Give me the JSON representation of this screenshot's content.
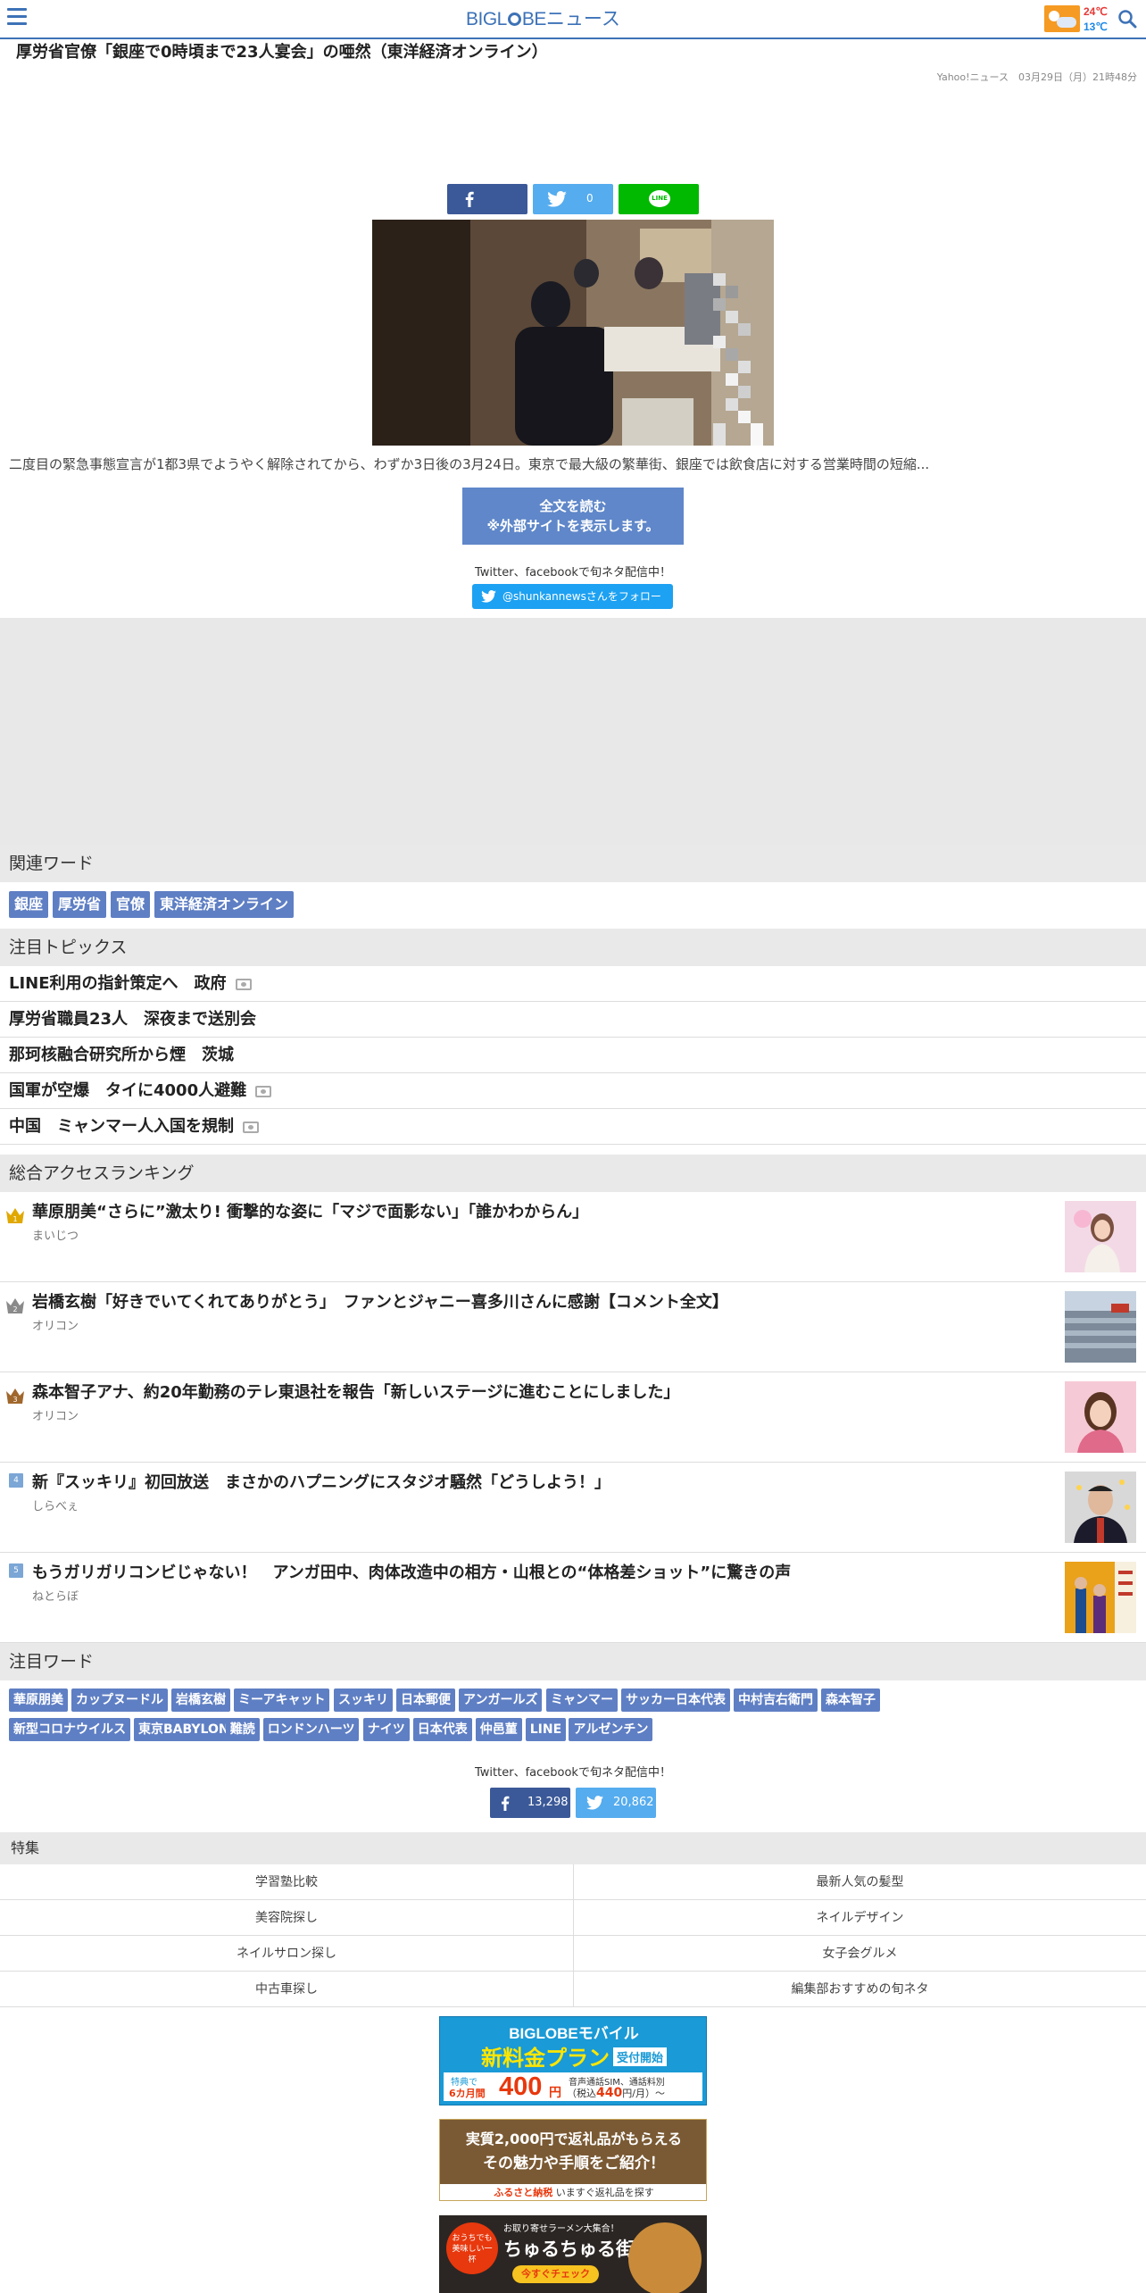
{
  "header": {
    "logo_brand": "BIGL",
    "logo_brand_end": "BE",
    "logo_suffix": "ニュース",
    "temp_high": "24℃",
    "temp_low": "13℃",
    "menu_icon": "hamburger-icon",
    "search_icon": "search-icon",
    "weather_icon": "sun-cloud-icon"
  },
  "article": {
    "title": "厚労省官僚「銀座で0時頃まで23人宴会」の唖然（東洋経済オンライン）",
    "meta": "Yahoo!ニュース　03月29日（月）21時48分",
    "share": {
      "twitter_count": "0",
      "line_label": "LINE"
    },
    "summary": "二度目の緊急事態宣言が1都3県でようやく解除されてから、わずか3日後の3月24日。東京で最大級の繁華街、銀座では飲食店に対する営業時間の短縮...",
    "read_line1": "全文を読む",
    "read_line2": "※外部サイトを表示します。",
    "promo": "Twitter、facebookで旬ネタ配信中！",
    "follow_label": "@shunkannewsさんをフォロー"
  },
  "related": {
    "heading": "関連ワード",
    "tags": [
      "銀座",
      "厚労省",
      "官僚",
      "東洋経済オンライン"
    ]
  },
  "topics": {
    "heading": "注目トピックス",
    "items": [
      {
        "label": "LINE利用の指針策定へ　政府",
        "icon": "video-icon"
      },
      {
        "label": "厚労省職員23人　深夜まで送別会",
        "icon": ""
      },
      {
        "label": "那珂核融合研究所から煙　茨城",
        "icon": ""
      },
      {
        "label": "国軍が空爆　タイに4000人避難",
        "icon": "camera-icon"
      },
      {
        "label": "中国　ミャンマー人入国を規制",
        "icon": "camera-icon"
      }
    ]
  },
  "ranking": {
    "heading": "総合アクセスランキング",
    "items": [
      {
        "rank": "1",
        "title": "華原朋美“さらに”激太り! 衝撃的な姿に「マジで面影ない」「誰かわからん」",
        "source": "まいじつ",
        "medal": "gold"
      },
      {
        "rank": "2",
        "title": "岩橋玄樹「好きでいてくれてありがとう」　ファンとジャニー喜多川さんに感謝【コメント全文】",
        "source": "オリコン",
        "medal": "silver"
      },
      {
        "rank": "3",
        "title": "森本智子アナ、約20年勤務のテレ東退社を報告「新しいステージに進むことにしました」",
        "source": "オリコン",
        "medal": "bronze"
      },
      {
        "rank": "4",
        "title": "新『スッキリ』初回放送　まさかのハプニングにスタジオ騒然「どうしよう！」",
        "source": "しらべぇ",
        "medal": ""
      },
      {
        "rank": "5",
        "title": "もうガリガリコンビじゃない！　アンガ田中、肉体改造中の相方・山根との“体格差ショット”に驚きの声",
        "source": "ねとらぼ",
        "medal": ""
      }
    ]
  },
  "keywords": {
    "heading": "注目ワード",
    "row1": [
      "華原朋美",
      "カップヌードル",
      "岩橋玄樹",
      "ミーアキャット",
      "スッキリ",
      "日本郵便",
      "アンガールズ",
      "ミャンマー",
      "サッカー日本代表",
      "中村吉右衛門",
      "森本智子"
    ],
    "row2": [
      "新型コロナウイルス",
      "東京BABYLON",
      "難読",
      "ロンドンハーツ",
      "ナイツ",
      "日本代表",
      "仲邑菫",
      "LINE",
      "アルゼンチン"
    ]
  },
  "social": {
    "promo": "Twitter、facebookで旬ネタ配信中！",
    "facebook_count": "13,298",
    "twitter_count": "20,862"
  },
  "features": {
    "heading": "特集",
    "items": [
      "学習塾比較",
      "最新人気の髪型",
      "美容院探し",
      "ネイルデザイン",
      "ネイルサロン探し",
      "女子会グルメ",
      "中古車探し",
      "編集部おすすめの旬ネタ"
    ]
  },
  "banners": {
    "mobile": {
      "line1": "BIGLOBEモバイル",
      "line2": "新料金プラン",
      "line2b": "受付開始",
      "small1": "特典で",
      "small2": "6カ月間",
      "price": "400",
      "yen": "円",
      "right1": "音声通話SIM、通話料別",
      "right2": "（税込",
      "right_price": "440",
      "right3": "円/月）〜"
    },
    "furusato": {
      "line1": "実質2,000円で返礼品がもらえる",
      "line2": "その魅力や手順をご紹介！",
      "footer_left": "ふるさと納税",
      "footer_right": "いますぐ返礼品を探す"
    },
    "ramen": {
      "circle": "おうちでも美味しい一杯",
      "top": "お取り寄せラーメン大集合！",
      "title": "ちゅるちゅる街",
      "cta": "今すぐチェック"
    }
  },
  "colors": {
    "brand": "#3d72b7",
    "tag": "#5f7fc4",
    "facebook": "#3b5998",
    "twitter": "#55acee",
    "line": "#00b900"
  }
}
